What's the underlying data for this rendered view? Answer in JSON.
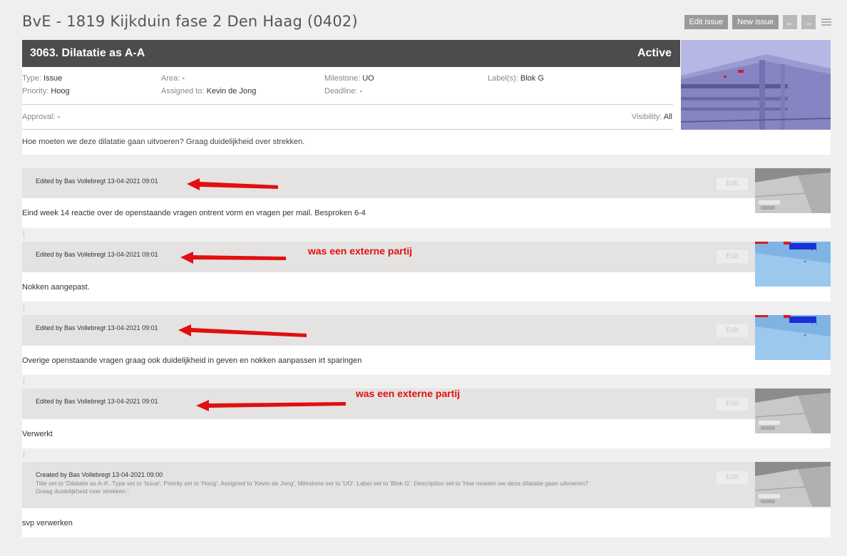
{
  "page": {
    "title": "BvE - 1819 Kijkduin fase 2 Den Haag (0402)"
  },
  "toolbar": {
    "edit_issue": "Edit issue",
    "new_issue": "New issue",
    "prev": "←",
    "next": "→"
  },
  "issue": {
    "title": "3063.  Dilatatie as A-A",
    "status": "Active",
    "type_label": "Type:",
    "type_value": "Issue",
    "priority_label": "Priority:",
    "priority_value": "Hoog",
    "area_label": "Area:",
    "area_value": "-",
    "assigned_label": "Assigned to:",
    "assigned_value": "Kevin de Jong",
    "milestone_label": "Milestone:",
    "milestone_value": "UO",
    "deadline_label": "Deadline:",
    "deadline_value": "-",
    "labels_label": "Label(s):",
    "labels_value": "Blok G",
    "approval_label": "Approval:",
    "approval_value": "-",
    "visibility_label": "Visibility:",
    "visibility_value": "All",
    "description": "Hoe moeten we deze dilatatie gaan uitvoeren? Graag duidelijkheid over strekken."
  },
  "entries": [
    {
      "byline": "Edited by Bas Vollebregt 13-04-2021 09:01",
      "text": "Eind week 14 reactie over de openstaande vragen ontrent vorm en vragen per mail. Besproken 6-4",
      "edit": "Edit"
    },
    {
      "byline": "Edited by Bas Vollebregt 13-04-2021 09:01",
      "text": "Nokken aangepast.",
      "edit": "Edit"
    },
    {
      "byline": "Edited by Bas Vollebregt 13-04-2021 09:01",
      "text": "Overige openstaande vragen graag ook duidelijkheid in geven en nokken aanpassen irt sparingen",
      "edit": "Edit"
    },
    {
      "byline": "Edited by Bas Vollebregt 13-04-2021 09:01",
      "text": "Verwerkt",
      "edit": "Edit"
    }
  ],
  "created": {
    "byline": "Created by Bas Vollebregt 13-04-2021 09:00",
    "detail": "Title set to 'Dilatatie as A-A'. Type set to 'Issue'. Priority set to 'Hoog'. Assigned to 'Kevin de Jong'. Milestone set to 'UO'. Label set to 'Blok G'. Description set to 'Hoe moeten we deze dilatatie gaan uitvoeren? Graag duidelijkheid over strekken.'.",
    "text": "svp verwerken",
    "edit": "Edit"
  },
  "annotations": [
    {
      "text": "was een externe partij"
    },
    {
      "text": "was een externe partij"
    }
  ],
  "colors": {
    "header_bg": "#4d4b4b",
    "annotation_red": "#e01010",
    "entry_head_bg": "#e4e3e2",
    "button_grey": "#9a9a9a"
  }
}
